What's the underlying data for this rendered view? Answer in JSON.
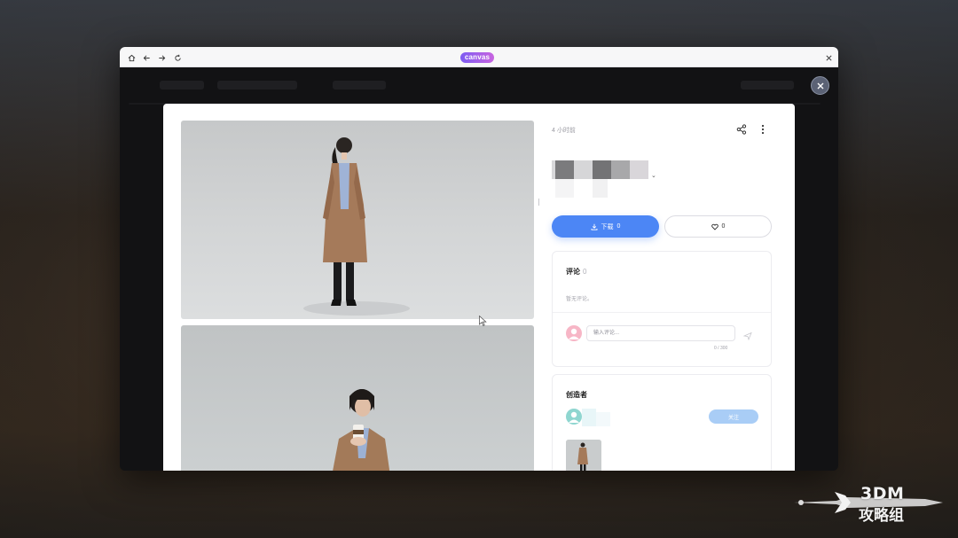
{
  "window": {
    "brand": "canvas",
    "nav_icons": [
      "home-icon",
      "back-arrow-icon",
      "forward-arrow-icon",
      "refresh-icon"
    ],
    "close_icon": "close-icon"
  },
  "detail": {
    "time_ago": "4 小时前",
    "download_label": "下载",
    "download_count": "0",
    "like_count": "0"
  },
  "comments": {
    "title": "评论",
    "count": "0",
    "empty_text": "暂无评论。",
    "input_placeholder": "输入评论...",
    "char_count": "0 / 300"
  },
  "creator": {
    "title": "创造者",
    "follow_label": "关注"
  },
  "watermark": {
    "line1": "3DM",
    "line2": "攻略组"
  },
  "colors": {
    "primary": "#4c86f5",
    "follow": "#a9cdf6",
    "brand_gradient_start": "#7d5cf2",
    "brand_gradient_end": "#c864e0"
  }
}
